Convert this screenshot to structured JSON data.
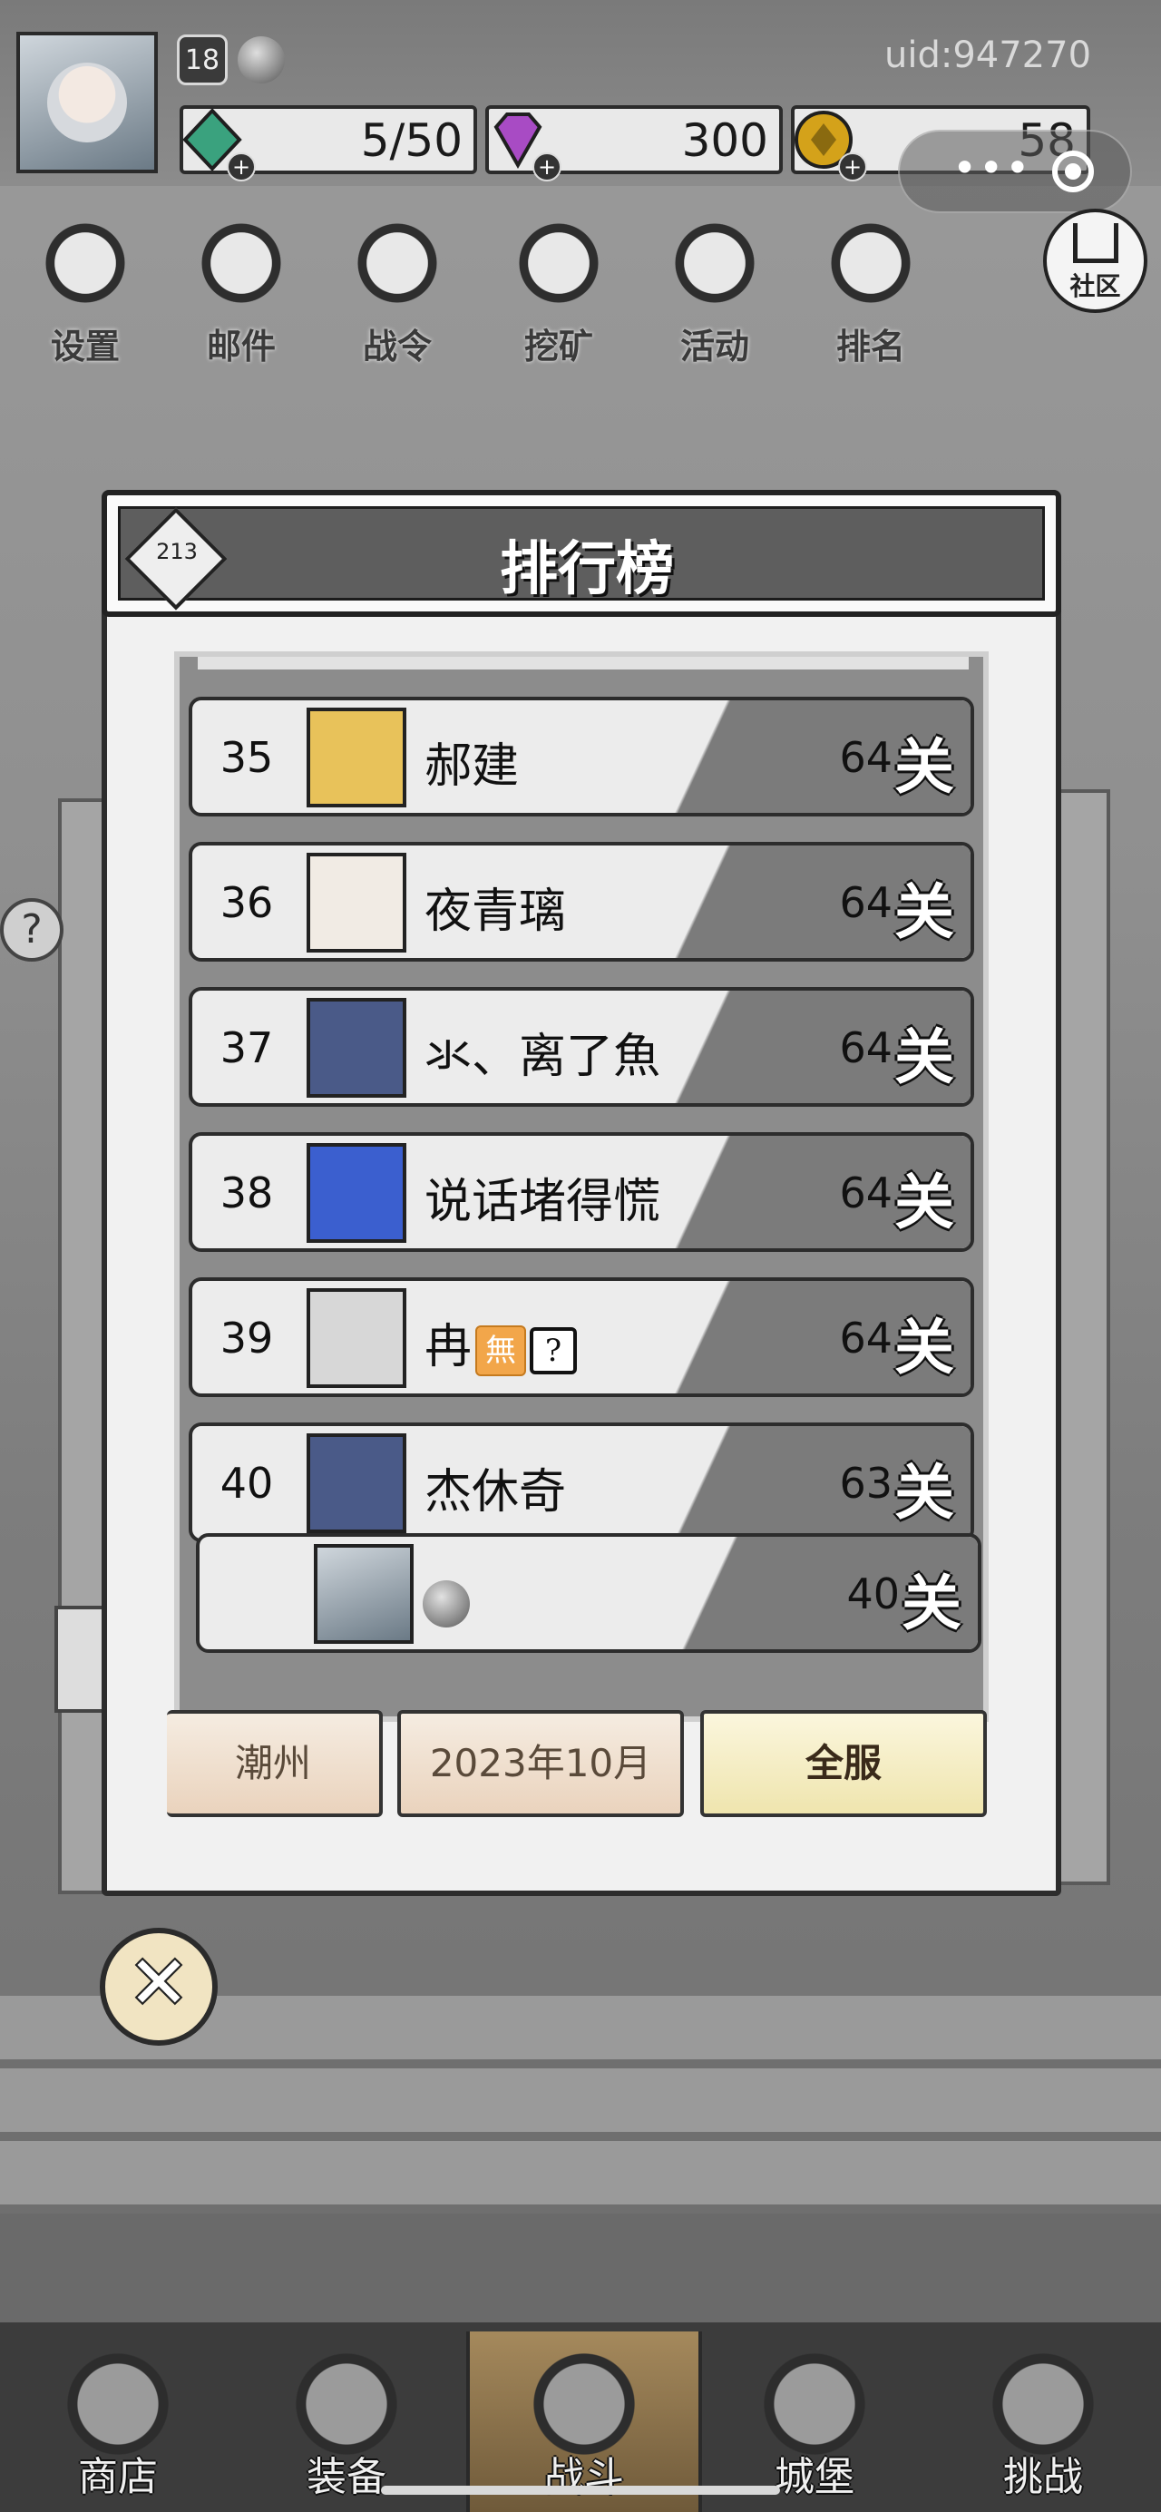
{
  "header": {
    "level": "18",
    "uid": "uid:947270",
    "stats": [
      {
        "name": "energy",
        "value": "5/50",
        "icon": "green-gem-icon",
        "color": "#3aa27e"
      },
      {
        "name": "diamonds",
        "value": "300",
        "icon": "purple-diamond-icon",
        "color": "#a84bc4"
      },
      {
        "name": "gold",
        "value": "58",
        "icon": "gold-coin-icon",
        "color": "#d4a21a"
      }
    ]
  },
  "menu": {
    "items": [
      {
        "label": "设置",
        "icon": "gear-icon"
      },
      {
        "label": "邮件",
        "icon": "envelope-icon"
      },
      {
        "label": "战令",
        "icon": "medal-icon"
      },
      {
        "label": "挖矿",
        "icon": "ore-icon"
      },
      {
        "label": "活动",
        "icon": "laurel-icon"
      },
      {
        "label": "排名",
        "icon": "podium-icon"
      }
    ],
    "community_label": "社区"
  },
  "dialog": {
    "title": "排行榜",
    "emblem_text": "213",
    "rows": [
      {
        "rank": "35",
        "name": "郝建",
        "score": "64",
        "unit": "关",
        "avatar_color": "#e8c25a"
      },
      {
        "rank": "36",
        "name": "夜青璃",
        "score": "64",
        "unit": "关",
        "avatar_color": "#f1ebe4"
      },
      {
        "rank": "37",
        "name": "氺、离了魚",
        "score": "64",
        "unit": "关",
        "avatar_color": "#4a5a88"
      },
      {
        "rank": "38",
        "name": "说话堵得慌",
        "score": "64",
        "unit": "关",
        "avatar_color": "#3b5fcf"
      },
      {
        "rank": "39",
        "name": "冉",
        "score": "64",
        "unit": "关",
        "avatar_color": "#d7d7d7",
        "tags": [
          "無",
          "?"
        ]
      },
      {
        "rank": "40",
        "name": "杰休奇",
        "score": "63",
        "unit": "关",
        "avatar_color": "#4a5a88"
      }
    ],
    "my_row": {
      "rank": "",
      "name": "",
      "score": "40",
      "unit": "关"
    },
    "filters": [
      {
        "label": "潮州",
        "active": false
      },
      {
        "label": "2023年10月",
        "active": false
      },
      {
        "label": "全服",
        "active": true
      }
    ],
    "close_symbol": "✕"
  },
  "bottom_nav": {
    "items": [
      {
        "label": "商店",
        "icon": "shop-icon"
      },
      {
        "label": "装备",
        "icon": "backpack-icon"
      },
      {
        "label": "战斗",
        "icon": "crossed-swords-icon",
        "active": true
      },
      {
        "label": "城堡",
        "icon": "castle-icon"
      },
      {
        "label": "挑战",
        "icon": "shield-icon"
      }
    ]
  }
}
